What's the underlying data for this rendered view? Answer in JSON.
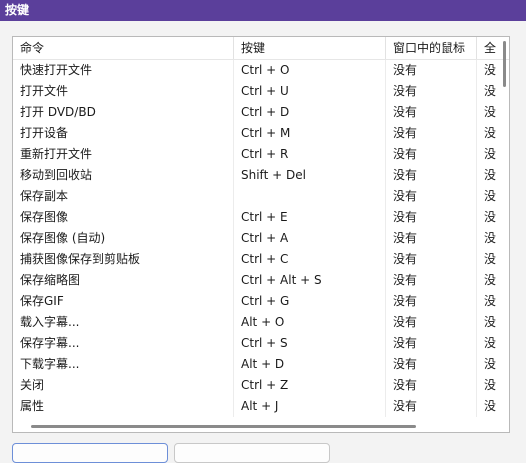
{
  "window": {
    "title": "按键"
  },
  "table": {
    "columns": [
      "命令",
      "按键",
      "窗口中的鼠标",
      "全"
    ],
    "rows": [
      [
        "快速打开文件",
        "Ctrl + O",
        "没有",
        "没"
      ],
      [
        "打开文件",
        "Ctrl + U",
        "没有",
        "没"
      ],
      [
        "打开 DVD/BD",
        "Ctrl + D",
        "没有",
        "没"
      ],
      [
        "打开设备",
        "Ctrl + M",
        "没有",
        "没"
      ],
      [
        "重新打开文件",
        "Ctrl + R",
        "没有",
        "没"
      ],
      [
        "移动到回收站",
        "Shift + Del",
        "没有",
        "没"
      ],
      [
        "保存副本",
        "",
        "没有",
        "没"
      ],
      [
        "保存图像",
        "Ctrl + E",
        "没有",
        "没"
      ],
      [
        "保存图像 (自动)",
        "Ctrl + A",
        "没有",
        "没"
      ],
      [
        "捕获图像保存到剪贴板",
        "Ctrl + C",
        "没有",
        "没"
      ],
      [
        "保存缩略图",
        "Ctrl + Alt + S",
        "没有",
        "没"
      ],
      [
        "保存GIF",
        "Ctrl + G",
        "没有",
        "没"
      ],
      [
        "载入字幕...",
        "Alt + O",
        "没有",
        "没"
      ],
      [
        "保存字幕...",
        "Ctrl + S",
        "没有",
        "没"
      ],
      [
        "下载字幕...",
        "Alt + D",
        "没有",
        "没"
      ],
      [
        "关闭",
        "Ctrl + Z",
        "没有",
        "没"
      ],
      [
        "属性",
        "Alt + J",
        "没有",
        "没"
      ]
    ]
  }
}
